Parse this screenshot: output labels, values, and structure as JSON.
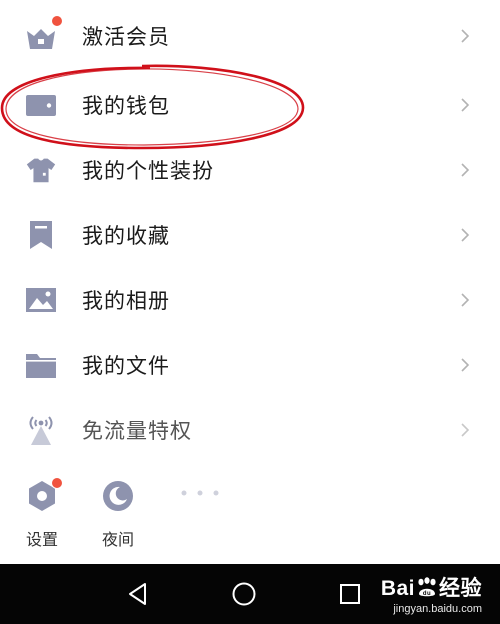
{
  "menu": {
    "items": [
      {
        "label": "激活会员",
        "icon": "vip-basket-icon"
      },
      {
        "label": "我的钱包",
        "icon": "wallet-icon"
      },
      {
        "label": "我的个性装扮",
        "icon": "tshirt-icon"
      },
      {
        "label": "我的收藏",
        "icon": "bookmark-icon"
      },
      {
        "label": "我的相册",
        "icon": "photo-icon"
      },
      {
        "label": "我的文件",
        "icon": "folder-icon"
      },
      {
        "label": "免流量特权",
        "icon": "signal-tower-icon"
      }
    ]
  },
  "tools": {
    "settings_label": "设置",
    "night_label": "夜间"
  },
  "watermark": {
    "brand_left": "Bai",
    "brand_right": "经验",
    "site": "jingyan.baidu.com"
  },
  "colors": {
    "icon": "#8e93ae",
    "badge": "#f0533f",
    "annotation": "#d0101a",
    "navbar": "#050505"
  }
}
